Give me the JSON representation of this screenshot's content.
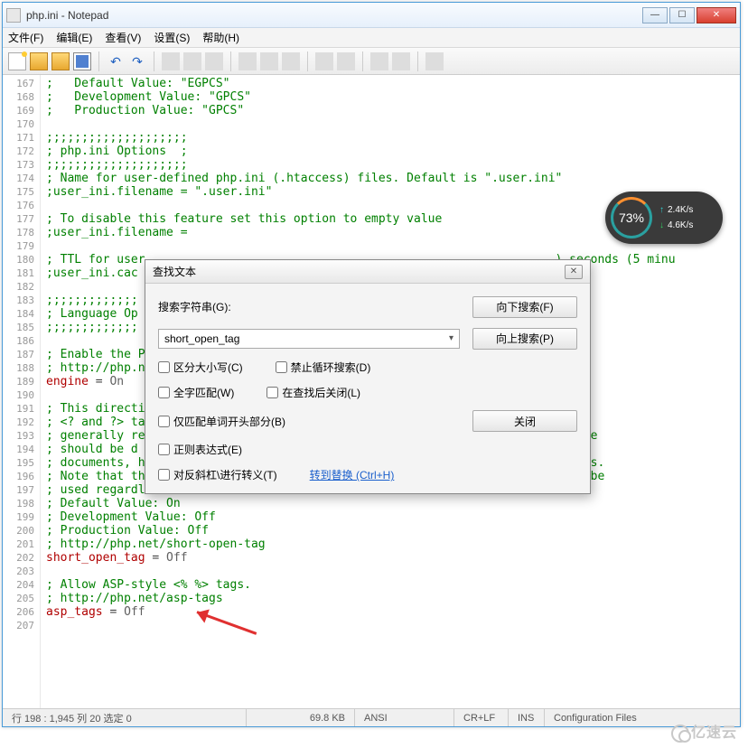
{
  "window": {
    "title": "php.ini - Notepad"
  },
  "menu": {
    "file": "文件(F)",
    "edit": "编辑(E)",
    "view": "查看(V)",
    "settings": "设置(S)",
    "help": "帮助(H)"
  },
  "lines": [
    {
      "n": 167,
      "text": ";   Default Value: \"EGPCS\"",
      "cls": "c-comment"
    },
    {
      "n": 168,
      "text": ";   Development Value: \"GPCS\"",
      "cls": "c-comment"
    },
    {
      "n": 169,
      "text": ";   Production Value: \"GPCS\"",
      "cls": "c-comment"
    },
    {
      "n": 170,
      "text": "",
      "cls": ""
    },
    {
      "n": 171,
      "text": ";;;;;;;;;;;;;;;;;;;;",
      "cls": "c-comment"
    },
    {
      "n": 172,
      "text": "; php.ini Options  ;",
      "cls": "c-comment"
    },
    {
      "n": 173,
      "text": ";;;;;;;;;;;;;;;;;;;;",
      "cls": "c-comment"
    },
    {
      "n": 174,
      "text": "; Name for user-defined php.ini (.htaccess) files. Default is \".user.ini\"",
      "cls": "c-comment"
    },
    {
      "n": 175,
      "text": ";user_ini.filename = \".user.ini\"",
      "cls": "c-comment"
    },
    {
      "n": 176,
      "text": "",
      "cls": ""
    },
    {
      "n": 177,
      "text": "; To disable this feature set this option to empty value",
      "cls": "c-comment"
    },
    {
      "n": 178,
      "text": ";user_ini.filename =",
      "cls": "c-comment"
    },
    {
      "n": 179,
      "text": "",
      "cls": ""
    },
    {
      "n": 180,
      "text": "; TTL for user                                                          ) seconds (5 minu",
      "cls": "c-comment"
    },
    {
      "n": 181,
      "text": ";user_ini.cac",
      "cls": "c-comment"
    },
    {
      "n": 182,
      "text": "",
      "cls": ""
    },
    {
      "n": 183,
      "text": ";;;;;;;;;;;;;",
      "cls": "c-comment"
    },
    {
      "n": 184,
      "text": "; Language Op",
      "cls": "c-comment"
    },
    {
      "n": 185,
      "text": ";;;;;;;;;;;;;",
      "cls": "c-comment"
    },
    {
      "n": 186,
      "text": "",
      "cls": ""
    },
    {
      "n": 187,
      "text": "; Enable the P",
      "cls": "c-comment"
    },
    {
      "n": 188,
      "text": "; http://php.n",
      "cls": "c-comment"
    },
    {
      "n": 189,
      "text": "engine = On",
      "cls": "c-assign"
    },
    {
      "n": 190,
      "text": "",
      "cls": ""
    },
    {
      "n": 191,
      "text": "; This directi",
      "cls": "c-comment"
    },
    {
      "n": 192,
      "text": "; <? and ?> ta",
      "cls": "c-comment"
    },
    {
      "n": 193,
      "text": "; generally re                                                               e",
      "cls": "c-comment"
    },
    {
      "n": 194,
      "text": "; should be d                                                                   ",
      "cls": "c-comment"
    },
    {
      "n": 195,
      "text": "; documents, however this remains supported for backward compatibility reasons.",
      "cls": "c-comment"
    },
    {
      "n": 196,
      "text": "; Note that this directive does not control the <?= shorthand tag, which can be",
      "cls": "c-comment"
    },
    {
      "n": 197,
      "text": "; used regardless of this directive.",
      "cls": "c-comment"
    },
    {
      "n": 198,
      "text": "; Default Value: On",
      "cls": "c-comment"
    },
    {
      "n": 199,
      "text": "; Development Value: Off",
      "cls": "c-comment"
    },
    {
      "n": 200,
      "text": "; Production Value: Off",
      "cls": "c-comment"
    },
    {
      "n": 201,
      "text": "; http://php.net/short-open-tag",
      "cls": "c-comment"
    },
    {
      "n": 202,
      "text": "short_open_tag = Off",
      "cls": "c-assign"
    },
    {
      "n": 203,
      "text": "",
      "cls": ""
    },
    {
      "n": 204,
      "text": "; Allow ASP-style <% %> tags.",
      "cls": "c-comment"
    },
    {
      "n": 205,
      "text": "; http://php.net/asp-tags",
      "cls": "c-comment"
    },
    {
      "n": 206,
      "text": "asp_tags = Off",
      "cls": "c-assign"
    },
    {
      "n": 207,
      "text": "",
      "cls": ""
    }
  ],
  "dialog": {
    "title": "查找文本",
    "search_label": "搜索字符串(G):",
    "search_value": "short_open_tag",
    "btn_down": "向下搜索(F)",
    "btn_up": "向上搜索(P)",
    "btn_close": "关闭",
    "chk_case": "区分大小写(C)",
    "chk_wrap": "禁止循环搜索(D)",
    "chk_whole": "全字匹配(W)",
    "chk_closeafter": "在查找后关闭(L)",
    "chk_wordstart": "仅匹配单词开头部分(B)",
    "chk_regex": "正则表达式(E)",
    "chk_escape": "对反斜杠\\进行转义(T)",
    "link_replace": "转到替换 (Ctrl+H)"
  },
  "status": {
    "pos": "行 198 : 1,945   列 20   选定 0",
    "size": "69.8 KB",
    "enc": "ANSI",
    "eol": "CR+LF",
    "mode": "INS",
    "type": "Configuration Files"
  },
  "net": {
    "pct": "73%",
    "up": "2.4K/s",
    "dn": "4.6K/s"
  },
  "watermark": "亿速云"
}
